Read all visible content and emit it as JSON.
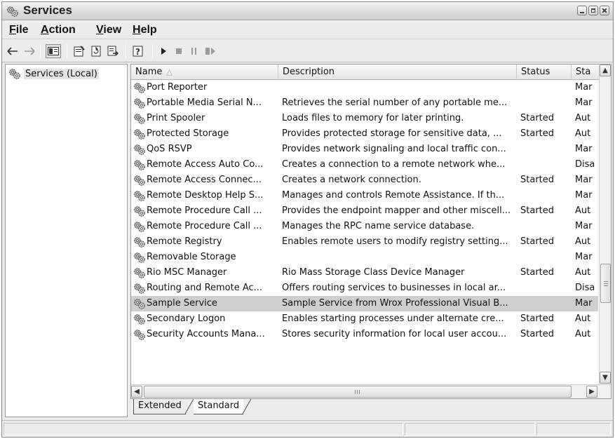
{
  "window": {
    "title": "Services",
    "title_icon": "services-gears-icon"
  },
  "menu": {
    "items": [
      {
        "label": "File",
        "accel": "F",
        "rest": "ile"
      },
      {
        "label": "Action",
        "accel": "A",
        "rest": "ction"
      },
      {
        "label": "View",
        "accel": "V",
        "rest": "iew"
      },
      {
        "label": "Help",
        "accel": "H",
        "rest": "elp"
      }
    ]
  },
  "toolbar": {
    "icons": [
      "back-arrow-icon",
      "forward-arrow-icon",
      "show-hide-console-tree-icon",
      "properties-icon",
      "refresh-icon",
      "export-list-icon",
      "help-icon",
      "start-service-icon",
      "stop-service-icon",
      "pause-service-icon",
      "restart-service-icon"
    ]
  },
  "tree": {
    "root_label": "Services (Local)"
  },
  "columns": {
    "name": "Name",
    "description": "Description",
    "status": "Status",
    "startup": "Sta"
  },
  "rows": [
    {
      "name": "Port Reporter",
      "description": "",
      "status": "",
      "startup": "Mar"
    },
    {
      "name": "Portable Media Serial N...",
      "description": "Retrieves the serial number of any portable me...",
      "status": "",
      "startup": "Mar"
    },
    {
      "name": "Print Spooler",
      "description": "Loads files to memory for later printing.",
      "status": "Started",
      "startup": "Aut"
    },
    {
      "name": "Protected Storage",
      "description": "Provides protected storage for sensitive data, ...",
      "status": "Started",
      "startup": "Aut"
    },
    {
      "name": "QoS RSVP",
      "description": "Provides network signaling and local traffic con...",
      "status": "",
      "startup": "Mar"
    },
    {
      "name": "Remote Access Auto Co...",
      "description": "Creates a connection to a remote network whe...",
      "status": "",
      "startup": "Disa"
    },
    {
      "name": "Remote Access Connec...",
      "description": "Creates a network connection.",
      "status": "Started",
      "startup": "Mar"
    },
    {
      "name": "Remote Desktop Help S...",
      "description": "Manages and controls Remote Assistance. If th...",
      "status": "",
      "startup": "Mar"
    },
    {
      "name": "Remote Procedure Call ...",
      "description": "Provides the endpoint mapper and other miscell...",
      "status": "Started",
      "startup": "Aut"
    },
    {
      "name": "Remote Procedure Call ...",
      "description": "Manages the RPC name service database.",
      "status": "",
      "startup": "Mar"
    },
    {
      "name": "Remote Registry",
      "description": "Enables remote users to modify registry setting...",
      "status": "Started",
      "startup": "Aut"
    },
    {
      "name": "Removable Storage",
      "description": "",
      "status": "",
      "startup": "Mar"
    },
    {
      "name": "Rio MSC Manager",
      "description": "Rio Mass Storage Class Device Manager",
      "status": "Started",
      "startup": "Aut"
    },
    {
      "name": "Routing and Remote Ac...",
      "description": "Offers routing services to businesses in local ar...",
      "status": "",
      "startup": "Disa"
    },
    {
      "name": "Sample Service",
      "description": "Sample Service from Wrox Professional Visual B...",
      "status": "",
      "startup": "Mar",
      "selected": true
    },
    {
      "name": "Secondary Logon",
      "description": "Enables starting processes under alternate cre...",
      "status": "Started",
      "startup": "Aut"
    },
    {
      "name": "Security Accounts Mana...",
      "description": "Stores security information for local user accou...",
      "status": "Started",
      "startup": "Aut"
    }
  ],
  "tabs": [
    {
      "label": "Extended"
    },
    {
      "label": "Standard",
      "active": true
    }
  ],
  "statusbar": {
    "text": ""
  }
}
